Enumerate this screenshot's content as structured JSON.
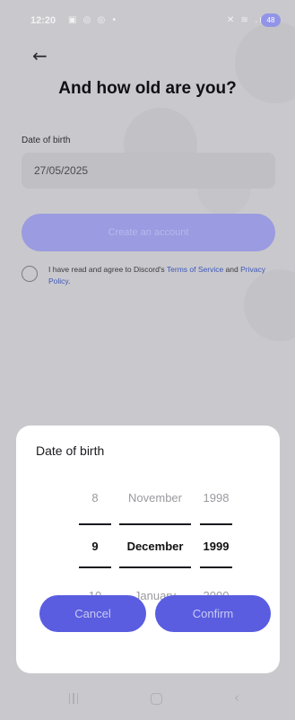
{
  "status_bar": {
    "time": "12:20",
    "left_icons": "▣ ◎ ◎ •",
    "right_icons": "✕ ≋ .ıl",
    "battery": "48"
  },
  "page": {
    "title": "And how old are you?",
    "dob_label": "Date of birth",
    "dob_value": "27/05/2025",
    "create_account_label": "Create an account",
    "agree_prefix": "I have read and agree to Discord's ",
    "terms_link": "Terms of Service",
    "agree_and": " and ",
    "privacy_link": "Privacy Policy",
    "agree_suffix": "."
  },
  "picker_sheet": {
    "title": "Date of birth",
    "day": {
      "above": "8",
      "selected": "9",
      "below": "10"
    },
    "month": {
      "above": "November",
      "selected": "December",
      "below": "January"
    },
    "year": {
      "above": "1998",
      "selected": "1999",
      "below": "2000"
    },
    "cancel_label": "Cancel",
    "confirm_label": "Confirm"
  },
  "colors": {
    "accent": "#5a5de0",
    "link": "#3e57b8"
  }
}
